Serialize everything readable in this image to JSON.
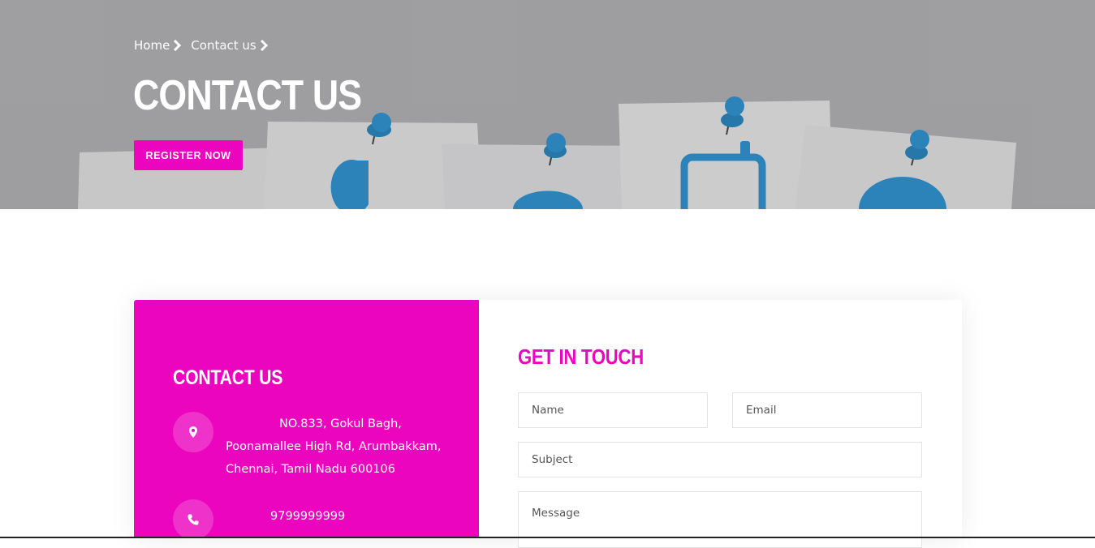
{
  "hero": {
    "breadcrumb": [
      {
        "label": "Home"
      },
      {
        "label": "Contact us"
      }
    ],
    "title": "CONTACT US",
    "register_label": "REGISTER NOW"
  },
  "contact_panel": {
    "title": "CONTACT US",
    "address_lines": [
      "NO.833, Gokul Bagh,",
      "Poonamallee High Rd, Arumbakkam,",
      "Chennai, Tamil Nadu 600106"
    ],
    "phone": "9799999999"
  },
  "form": {
    "title": "GET IN TOUCH",
    "name_placeholder": "Name",
    "email_placeholder": "Email",
    "subject_placeholder": "Subject",
    "message_placeholder": "Message"
  },
  "colors": {
    "accent": "#ec05bf",
    "hero_bg": "#a7a7a9",
    "pin_blue": "#1b86c9"
  },
  "icons": [
    "chevron-right-icon",
    "location-pin-icon",
    "phone-icon"
  ]
}
